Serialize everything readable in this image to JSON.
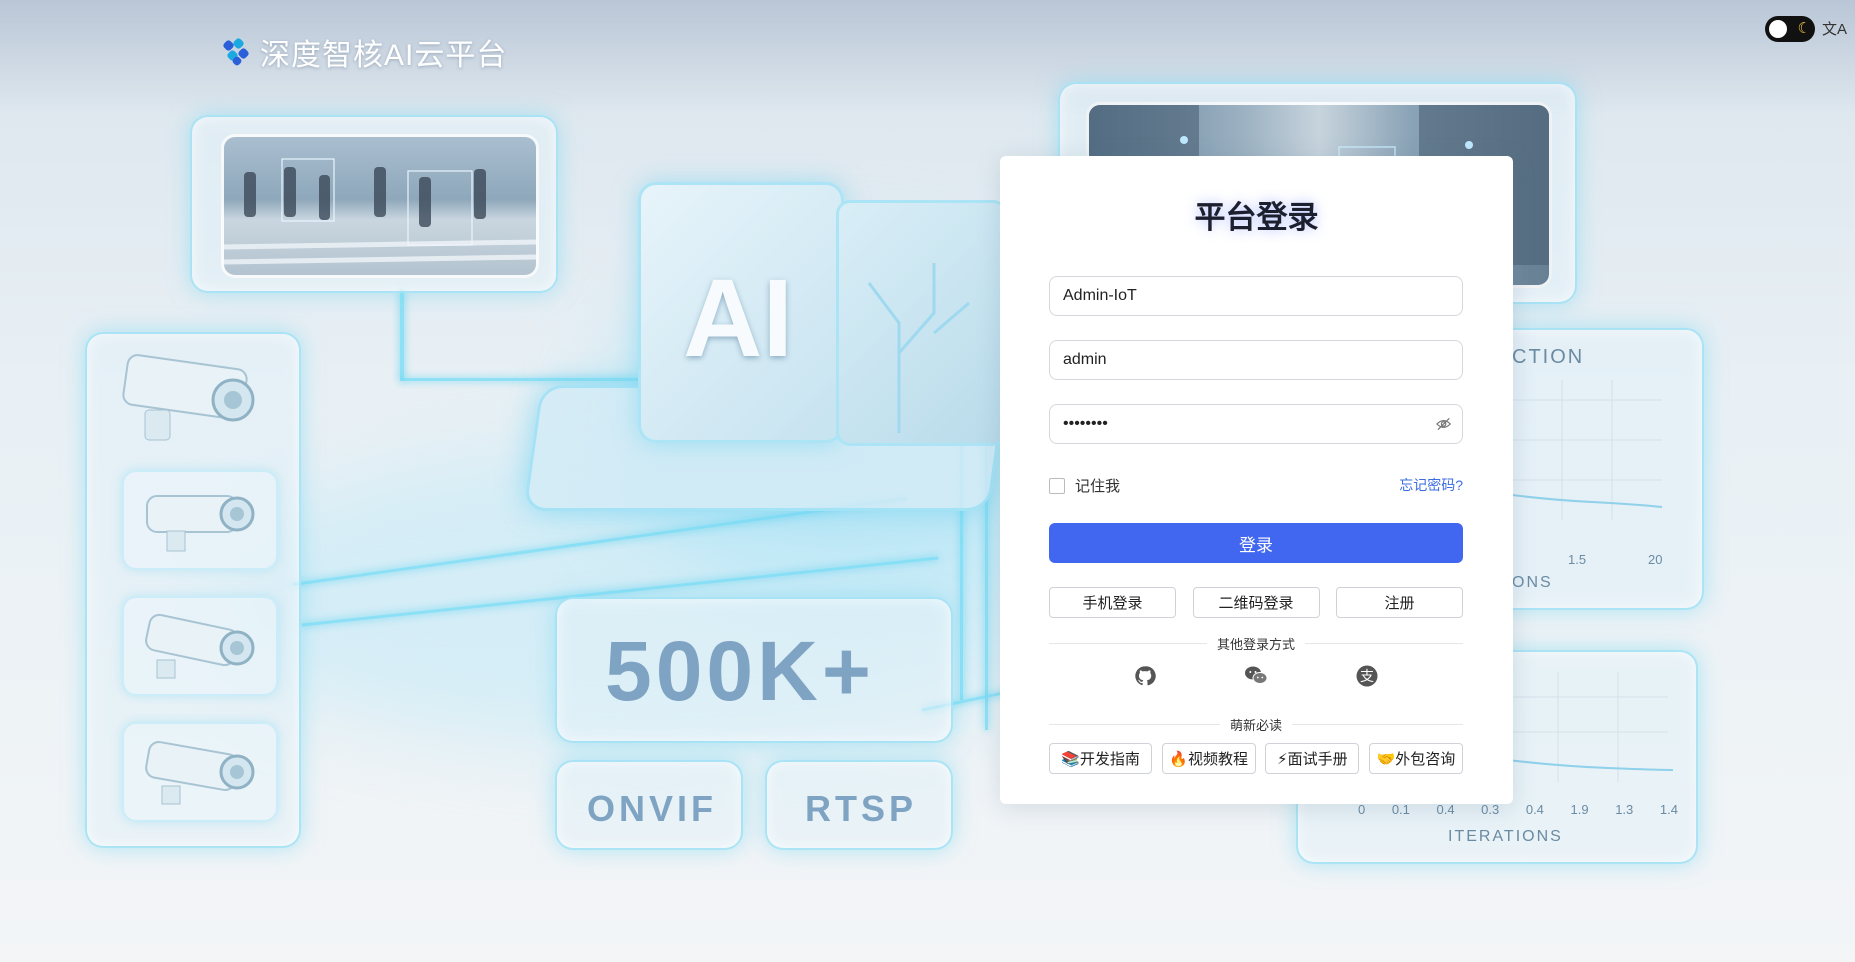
{
  "header": {
    "title": "深度智核AI云平台",
    "logo_icon": "layered-stripes-logo"
  },
  "topbar": {
    "theme_toggle_icon": "moon-icon",
    "theme_moon": "☾",
    "lang_icon": "translate-icon",
    "lang_glyph": "文A"
  },
  "background": {
    "ai_label": "AI",
    "stat": "500K+",
    "protocols": [
      "ONVIF",
      "RTSP"
    ],
    "chart1_title": "CTION",
    "chart1_axis": "ONS",
    "chart1_ticks": [
      "1.5",
      "20"
    ],
    "chart2_axis": "ITERATIONS",
    "chart2_ticks": [
      "0",
      "0.1",
      "0.4",
      "0.3",
      "0.4",
      "1.9",
      "1.3",
      "1.4"
    ]
  },
  "login": {
    "title": "平台登录",
    "tenant_value": "Admin-IoT",
    "username_value": "admin",
    "password_value": "••••••••",
    "remember_label": "记住我",
    "forgot_label": "忘记密码?",
    "submit_label": "登录",
    "alt_methods": [
      "手机登录",
      "二维码登录",
      "注册"
    ],
    "other_methods_label": "其他登录方式",
    "social": [
      "github-icon",
      "wechat-icon",
      "alipay-icon"
    ],
    "newbie_label": "萌新必读",
    "guide_links": [
      "📚开发指南",
      "🔥视频教程",
      "⚡面试手册",
      "🤝外包咨询"
    ]
  },
  "colors": {
    "primary": "#4167f0",
    "link": "#3b6de3",
    "glow": "#78d7f0"
  }
}
